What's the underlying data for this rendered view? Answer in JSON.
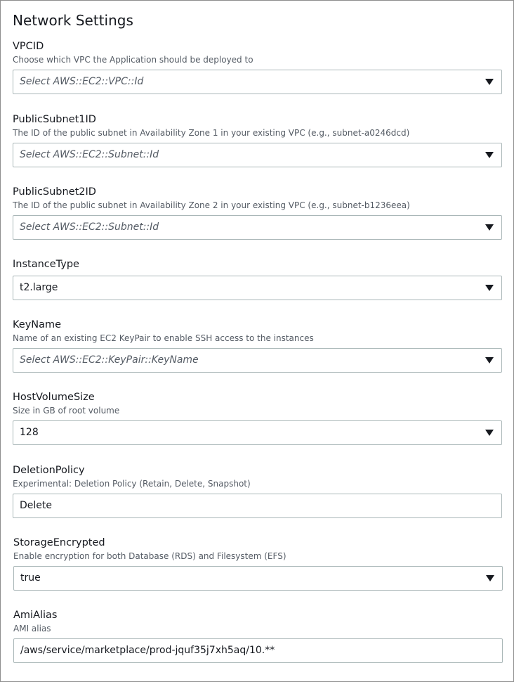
{
  "section_title": "Network Settings",
  "fields": [
    {
      "label": "VPCID",
      "description": "Choose which VPC the Application should be deployed to",
      "placeholder": "Select AWS::EC2::VPC::Id",
      "value": ""
    },
    {
      "label": "PublicSubnet1ID",
      "description": "The ID of the public subnet in Availability Zone 1 in your existing VPC (e.g., subnet-a0246dcd)",
      "placeholder": "Select AWS::EC2::Subnet::Id",
      "value": ""
    },
    {
      "label": "PublicSubnet2ID",
      "description": "The ID of the public subnet in Availability Zone 2 in your existing VPC (e.g., subnet-b1236eea)",
      "placeholder": "Select AWS::EC2::Subnet::Id",
      "value": ""
    },
    {
      "label": "InstanceType",
      "description": "",
      "placeholder": "",
      "value": "t2.large"
    },
    {
      "label": "KeyName",
      "description": "Name of an existing EC2 KeyPair to enable SSH access to the instances",
      "placeholder": "Select AWS::EC2::KeyPair::KeyName",
      "value": ""
    },
    {
      "label": "HostVolumeSize",
      "description": "Size in GB of root volume",
      "placeholder": "",
      "value": "128"
    },
    {
      "label": "DeletionPolicy",
      "description": "Experimental: Deletion Policy (Retain, Delete, Snapshot)",
      "placeholder": "",
      "value": "Delete"
    },
    {
      "label": "StorageEncrypted",
      "description": "Enable encryption for both Database (RDS) and Filesystem (EFS)",
      "placeholder": "",
      "value": "true"
    },
    {
      "label": "AmiAlias",
      "description": "AMI alias",
      "placeholder": "",
      "value": "/aws/service/marketplace/prod-jquf35j7xh5aq/10.**"
    }
  ],
  "icons": {
    "dropdown": "caret-down-icon"
  }
}
